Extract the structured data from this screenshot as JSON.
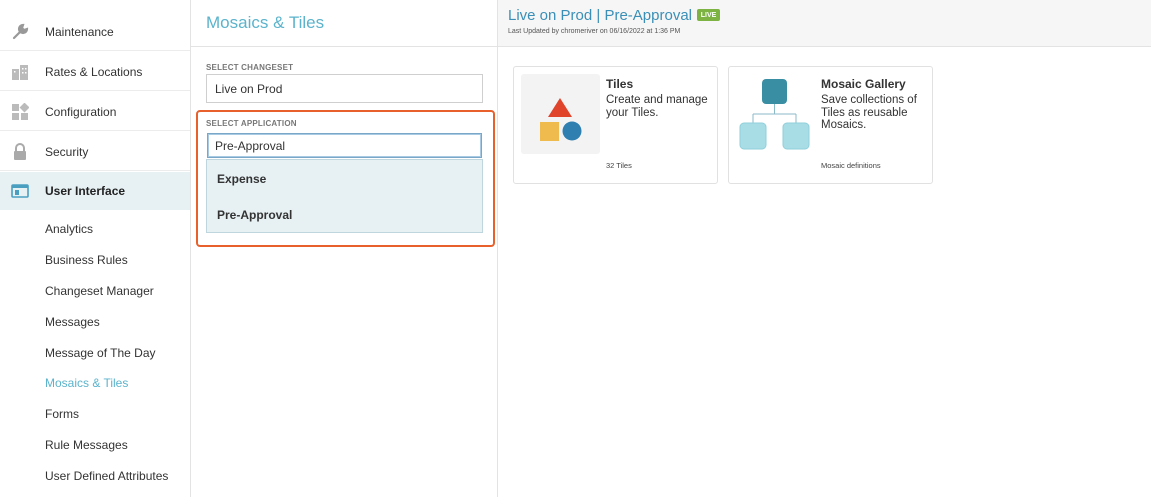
{
  "sidebar": {
    "items": [
      {
        "label": "Maintenance",
        "icon": "wrench-icon"
      },
      {
        "label": "Rates & Locations",
        "icon": "buildings-icon"
      },
      {
        "label": "Configuration",
        "icon": "configuration-icon"
      },
      {
        "label": "Security",
        "icon": "lock-icon"
      },
      {
        "label": "User Interface",
        "icon": "window-icon",
        "active": true
      }
    ],
    "sub_items": [
      "Analytics",
      "Business Rules",
      "Changeset Manager",
      "Messages",
      "Message of The Day",
      "Mosaics & Tiles",
      "Forms",
      "Rule Messages",
      "User Defined Attributes"
    ],
    "current_sub_item": "Mosaics & Tiles"
  },
  "middle": {
    "title": "Mosaics & Tiles",
    "changeset_label": "SELECT CHANGESET",
    "changeset_value": "Live on Prod",
    "application_label": "SELECT APPLICATION",
    "application_value": "Pre-Approval",
    "application_options": [
      "Expense",
      "Pre-Approval"
    ]
  },
  "main": {
    "title": "Live on Prod | Pre-Approval",
    "badge": "LIVE",
    "updated": "Last Updated by chromeriver on 06/16/2022 at 1:36 PM",
    "cards": [
      {
        "title": "Tiles",
        "description": "Create and manage your Tiles.",
        "footer": "32 Tiles",
        "icon": "shapes-icon"
      },
      {
        "title": "Mosaic Gallery",
        "description": "Save collections of Tiles as reusable Mosaics.",
        "footer": "Mosaic definitions",
        "icon": "tree-icon"
      }
    ]
  },
  "colors": {
    "accent": "#5bb3cc",
    "title_blue": "#3a8fb7",
    "highlight_orange": "#e8612c",
    "live_green": "#7cb342",
    "active_bg": "#e7f1f4"
  }
}
